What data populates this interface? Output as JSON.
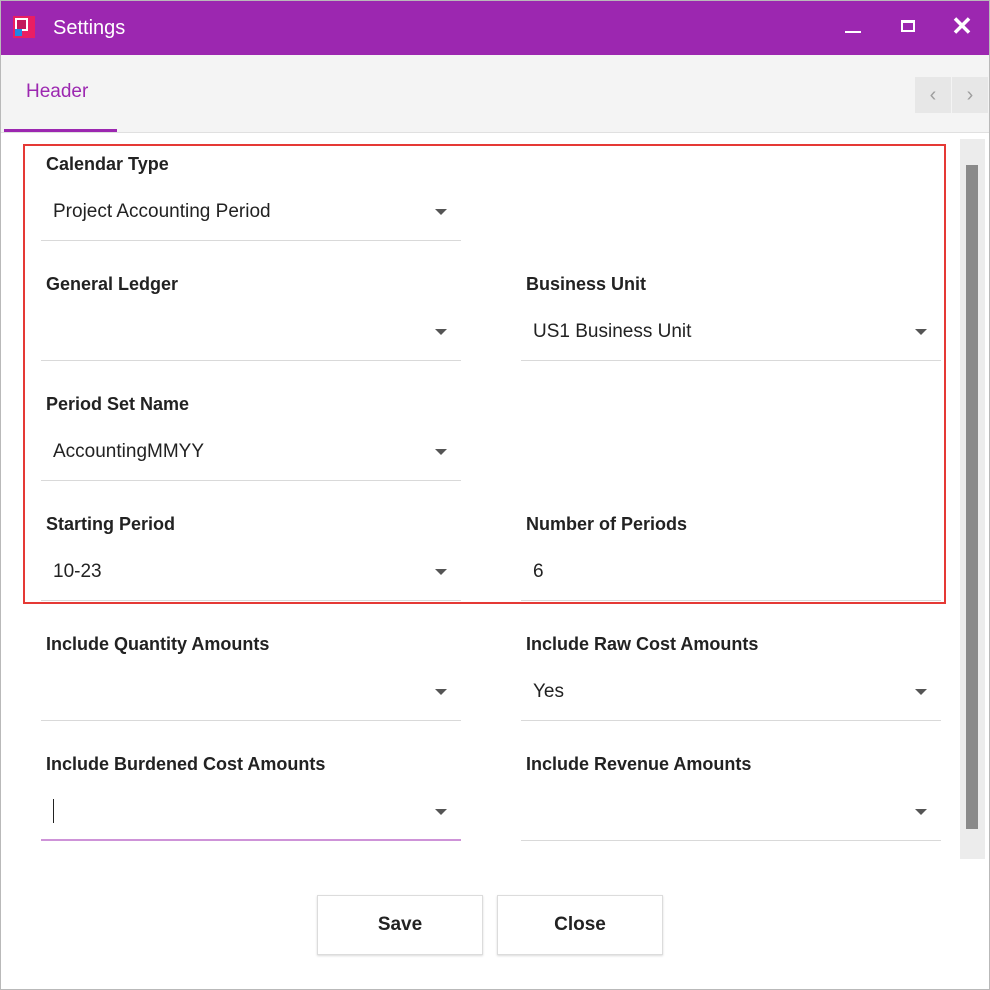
{
  "window": {
    "title": "Settings",
    "minimize_icon": "minimize-icon",
    "maximize_icon": "maximize-icon",
    "close_icon": "close-icon",
    "close_glyph": "✕",
    "titlebar_color": "#9c27b0"
  },
  "tabs": {
    "active": "Header",
    "items": [
      {
        "label": "Header"
      }
    ],
    "prev_glyph": "‹",
    "next_glyph": "›"
  },
  "form": {
    "calendar_type": {
      "label": "Calendar Type",
      "value": "Project Accounting Period"
    },
    "general_ledger": {
      "label": "General Ledger",
      "value": ""
    },
    "business_unit": {
      "label": "Business Unit",
      "value": "US1 Business Unit"
    },
    "period_set_name": {
      "label": "Period Set Name",
      "value": "AccountingMMYY"
    },
    "starting_period": {
      "label": "Starting Period",
      "value": "10-23"
    },
    "number_of_periods": {
      "label": "Number of Periods",
      "value": "6"
    },
    "include_quantity_amounts": {
      "label": "Include Quantity Amounts",
      "value": ""
    },
    "include_raw_cost_amounts": {
      "label": "Include Raw Cost Amounts",
      "value": "Yes"
    },
    "include_burdened_cost_amounts": {
      "label": "Include Burdened Cost Amounts",
      "value": ""
    },
    "include_revenue_amounts": {
      "label": "Include Revenue Amounts",
      "value": ""
    }
  },
  "footer": {
    "save_label": "Save",
    "close_label": "Close"
  },
  "colors": {
    "accent": "#9c27b0",
    "highlight_border": "#e53935"
  }
}
